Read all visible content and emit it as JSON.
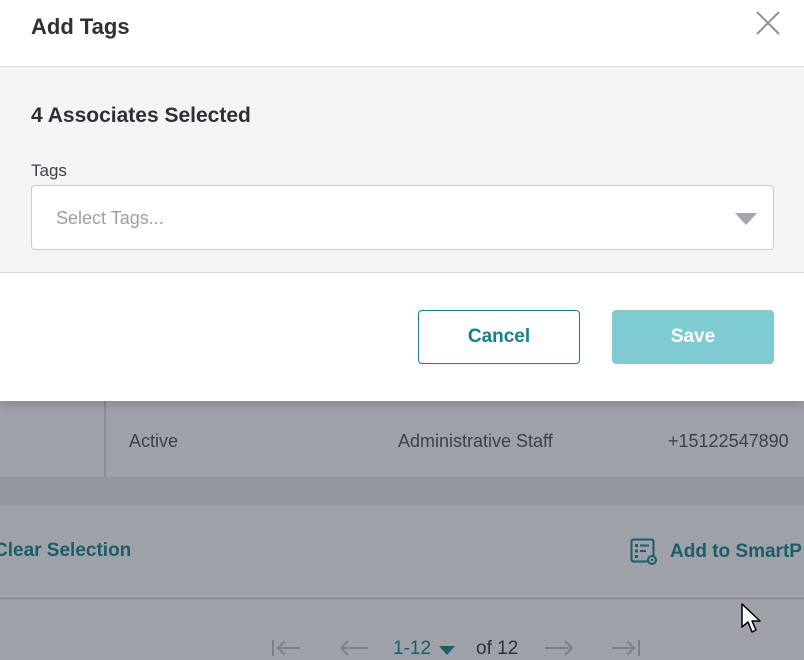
{
  "modal": {
    "title": "Add Tags",
    "selected_count": "4 Associates Selected",
    "tags_label": "Tags",
    "tags_placeholder": "Select Tags...",
    "cancel_label": "Cancel",
    "save_label": "Save"
  },
  "background": {
    "row": {
      "status": "Active",
      "role": "Administrative Staff",
      "phone": "+15122547890"
    },
    "actions": {
      "clear_label": "Clear Selection",
      "smart_label": "Add to SmartP"
    },
    "pager": {
      "range": "1-12",
      "of_total": "of 12"
    }
  },
  "colors": {
    "accent": "#16808d",
    "save_disabled": "#7fcbd2",
    "overlay": "#9ea1a8"
  }
}
